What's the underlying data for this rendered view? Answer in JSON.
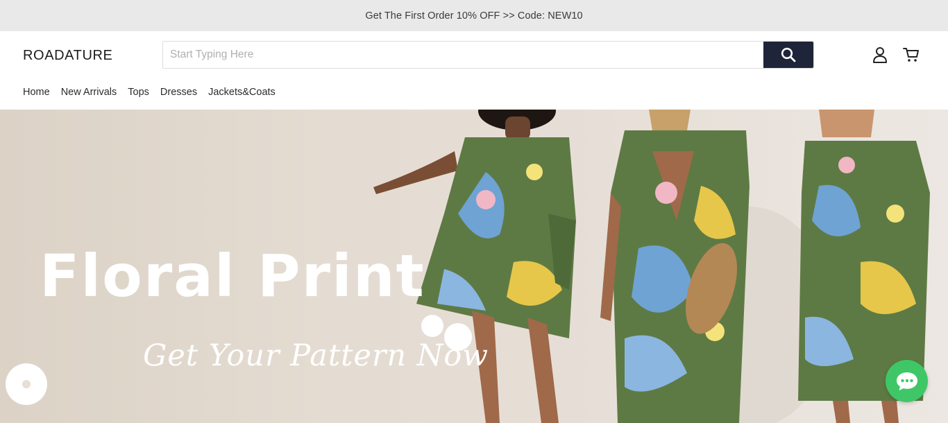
{
  "announcement": "Get The First Order 10% OFF >> Code: NEW10",
  "header": {
    "logo": "ROADATURE",
    "search": {
      "placeholder": "Start Typing Here",
      "value": ""
    },
    "icons": [
      "search-icon",
      "account-icon",
      "cart-icon"
    ]
  },
  "nav": {
    "items": [
      "Home",
      "New Arrivals",
      "Tops",
      "Dresses",
      "Jackets&Coats"
    ]
  },
  "hero": {
    "title": "Floral Print",
    "subtitle": "Get Your Pattern Now"
  },
  "chat": {
    "icon": "chat-bubble-icon"
  },
  "colors": {
    "announcement_bg": "#e9e9e9",
    "search_button": "#1f2538",
    "chat_button": "#3fc767",
    "dress_green": "#5e7a44",
    "hero_bg": "#e4dcd2"
  }
}
